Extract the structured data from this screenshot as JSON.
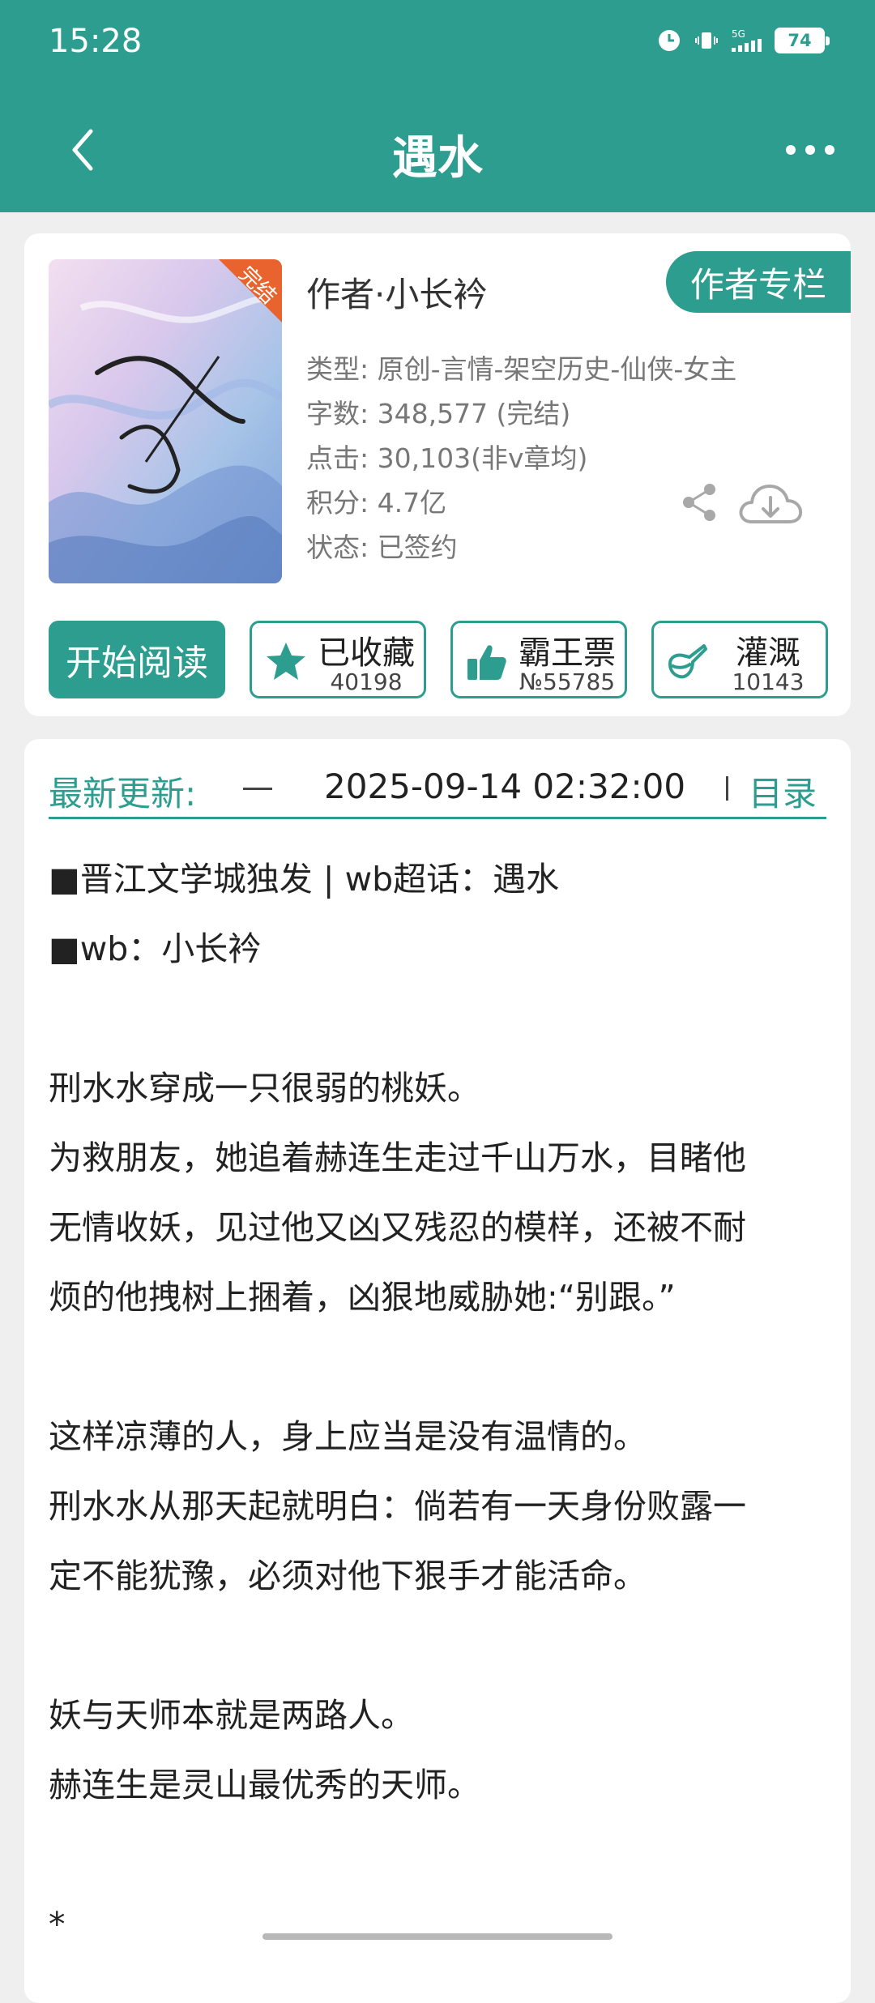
{
  "status_bar": {
    "time": "15:28",
    "network": "5G",
    "battery": "74"
  },
  "header": {
    "title": "遇水"
  },
  "book": {
    "cover_badge": "完结",
    "cover_title": "遇水",
    "author_line": "作者·小长衿",
    "author_column_label": "作者专栏",
    "meta": [
      "类型: 原创-言情-架空历史-仙侠-女主",
      "字数: 348,577 (完结)",
      "点击: 30,103(非v章均)",
      "积分: 4.7亿",
      "状态: 已签约"
    ]
  },
  "actions": {
    "read_label": "开始阅读",
    "favorite": {
      "label": "已收藏",
      "count": "40198"
    },
    "vote": {
      "label": "霸王票",
      "count": "№55785"
    },
    "water": {
      "label": "灌溉",
      "count": "10143"
    }
  },
  "update": {
    "label": "最新更新:",
    "time": "2025-09-14 02:32:00",
    "toc_label": "目录"
  },
  "intro": [
    "■晋江文学城独发 | wb超话：遇水",
    "■wb：小长衿",
    "",
    "刑水水穿成一只很弱的桃妖。",
    "为救朋友，她追着赫连生走过千山万水，目睹他",
    "无情收妖，见过他又凶又残忍的模样，还被不耐",
    "烦的他拽树上捆着，凶狠地威胁她:“别跟。”",
    "",
    "这样凉薄的人，身上应当是没有温情的。",
    "刑水水从那天起就明白：倘若有一天身份败露一",
    "定不能犹豫，必须对他下狠手才能活命。",
    "",
    "妖与天师本就是两路人。",
    "赫连生是灵山最优秀的天师。",
    "",
    "*"
  ],
  "colors": {
    "accent": "#2c9d8f",
    "page_bg": "#efefef"
  },
  "icons": [
    "back-arrow-icon",
    "more-icon",
    "share-icon",
    "cloud-download-icon",
    "star-icon",
    "thumbs-up-icon",
    "watering-can-icon"
  ]
}
